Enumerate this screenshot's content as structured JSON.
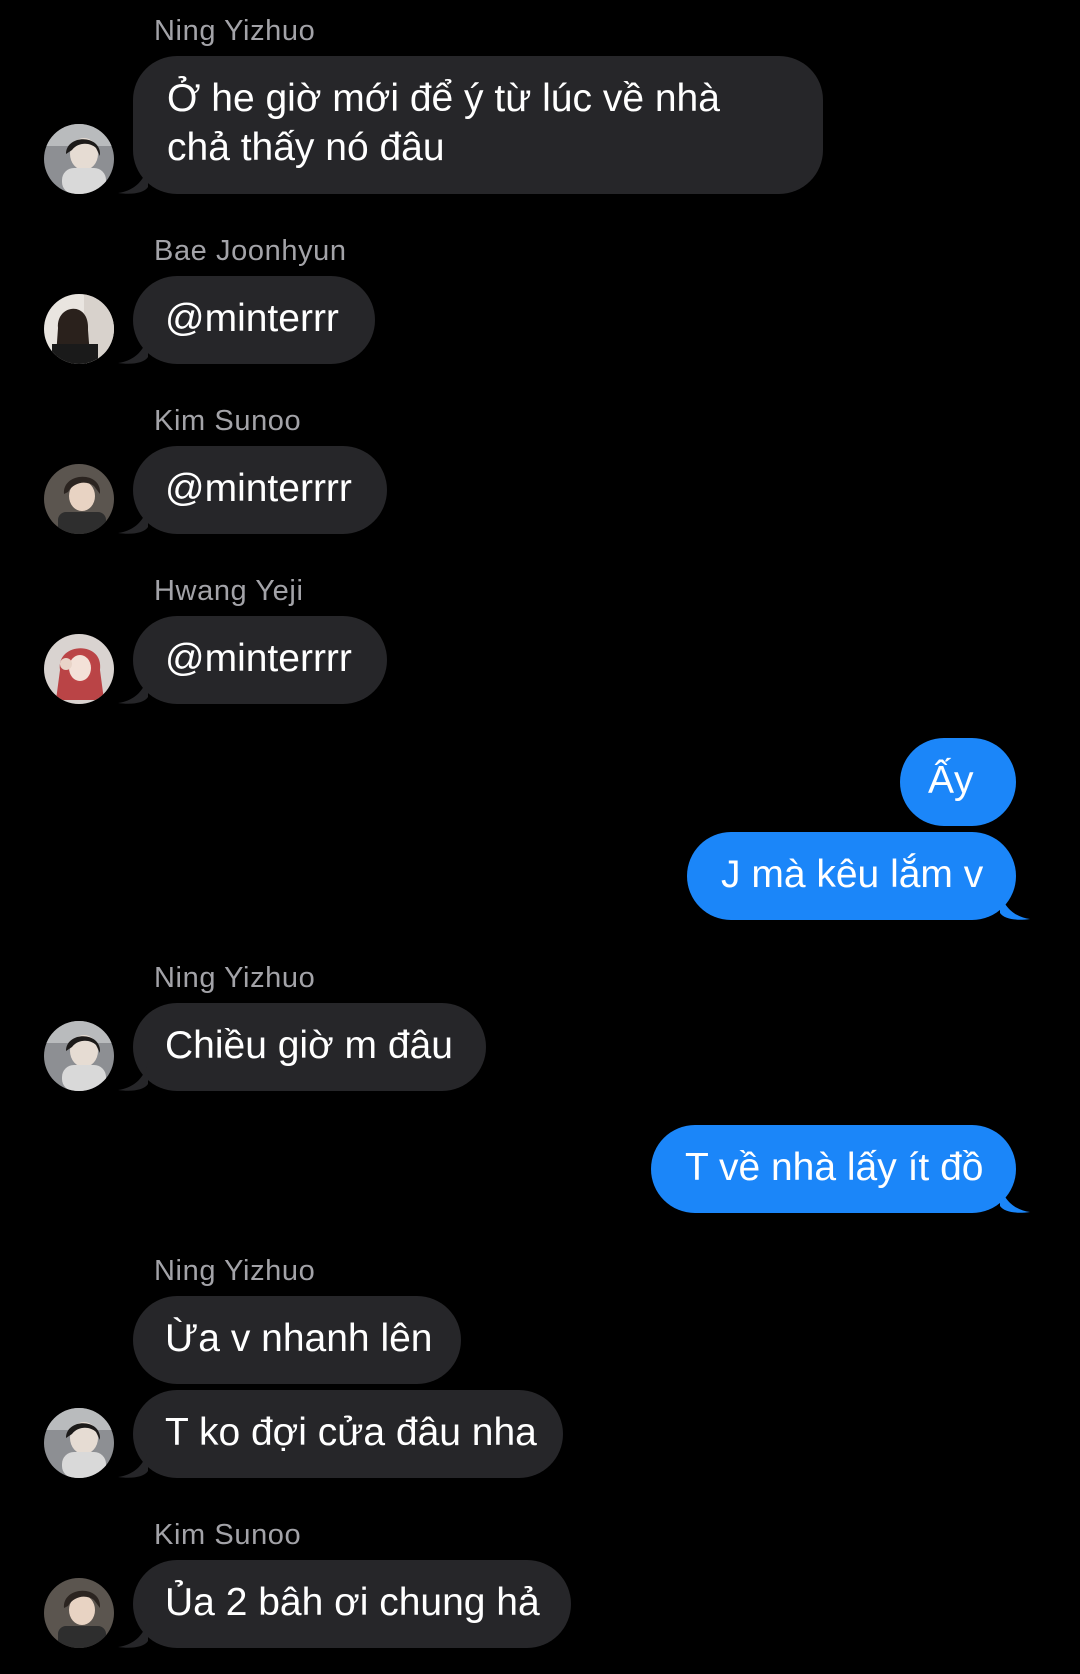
{
  "messages": [
    {
      "sender": "Ning Yizhuo",
      "text": "Ở he giờ mới để ý từ lúc về nhà chả thấy nó đâu"
    },
    {
      "sender": "Bae Joonhyun",
      "text": "@minterrr"
    },
    {
      "sender": "Kim Sunoo",
      "text": "@minterrrr"
    },
    {
      "sender": "Hwang Yeji",
      "text": "@minterrrr"
    },
    {
      "sender": "me",
      "text": "Ấy"
    },
    {
      "sender": "me",
      "text": "J mà kêu lắm v"
    },
    {
      "sender": "Ning Yizhuo",
      "text": "Chiều giờ m đâu"
    },
    {
      "sender": "me",
      "text": "T về nhà lấy ít đồ"
    },
    {
      "sender": "Ning Yizhuo",
      "text": "Ừa v nhanh lên"
    },
    {
      "sender": "Ning Yizhuo",
      "text": "T ko đợi cửa đâu nha"
    },
    {
      "sender": "Kim Sunoo",
      "text": "Ủa 2 bâh ơi chung hả"
    }
  ],
  "colors": {
    "background": "#000000",
    "incoming_bubble": "#262629",
    "outgoing_bubble": "#1b86f9",
    "sender_name": "#a3a3a8",
    "text": "#ffffff"
  }
}
